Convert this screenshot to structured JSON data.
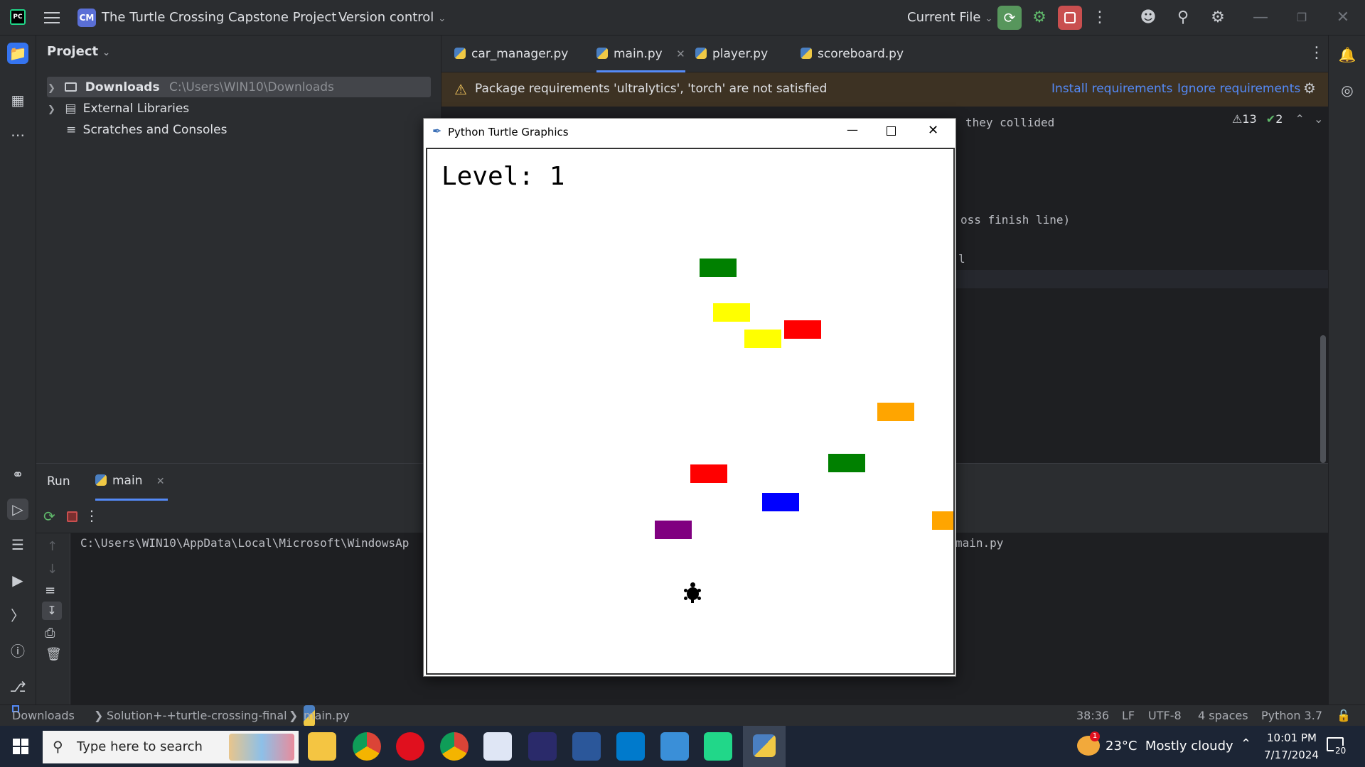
{
  "titlebar": {
    "logo": "PC",
    "project_badge": "CM",
    "project_name": "The Turtle Crossing Capstone Project",
    "vcs": "Version control",
    "run_config": "Current File"
  },
  "project_panel": {
    "title": "Project",
    "items": [
      {
        "label": "Downloads",
        "path": "C:\\Users\\WIN10\\Downloads"
      },
      {
        "label": "External Libraries"
      },
      {
        "label": "Scratches and Consoles"
      }
    ]
  },
  "tabs": [
    {
      "label": "car_manager.py"
    },
    {
      "label": "main.py",
      "active": true
    },
    {
      "label": "player.py"
    },
    {
      "label": "scoreboard.py"
    }
  ],
  "warning": {
    "text": "Package requirements 'ultralytics', 'torch' are not satisfied",
    "install": "Install requirements",
    "ignore": "Ignore requirements"
  },
  "inspections": {
    "warnings": "13",
    "checks": "2"
  },
  "code_fragments": {
    "line1": "they collided",
    "line2": "oss finish line)",
    "line3": "l"
  },
  "run": {
    "title": "Run",
    "tab": "main",
    "output_left": "C:\\Users\\WIN10\\AppData\\Local\\Microsoft\\WindowsAp",
    "output_right": "main.py"
  },
  "statusbar": {
    "crumbs": [
      "Downloads",
      "Solution+-+turtle-crossing-final",
      "main.py"
    ],
    "position": "38:36",
    "line_sep": "LF",
    "encoding": "UTF-8",
    "indent": "4 spaces",
    "interpreter": "Python 3.7"
  },
  "turtle_window": {
    "title": "Python Turtle Graphics",
    "level_text": "Level: 1",
    "cars": [
      {
        "color": "#008000"
      },
      {
        "color": "#ffff00"
      },
      {
        "color": "#ffff00"
      },
      {
        "color": "#ff0000"
      },
      {
        "color": "#ffa500"
      },
      {
        "color": "#008000"
      },
      {
        "color": "#ff0000"
      },
      {
        "color": "#0000ff"
      },
      {
        "color": "#800080"
      },
      {
        "color": "#ffa500"
      }
    ]
  },
  "taskbar": {
    "search_placeholder": "Type here to search",
    "weather": "23°C  Mostly cloudy",
    "time": "10:01 PM",
    "date": "7/17/2024",
    "notifications": "20",
    "weather_badge": "1"
  },
  "colors": {
    "accent_blue": "#548af7",
    "run_green": "#57965c",
    "stop_red": "#c94f4f"
  }
}
